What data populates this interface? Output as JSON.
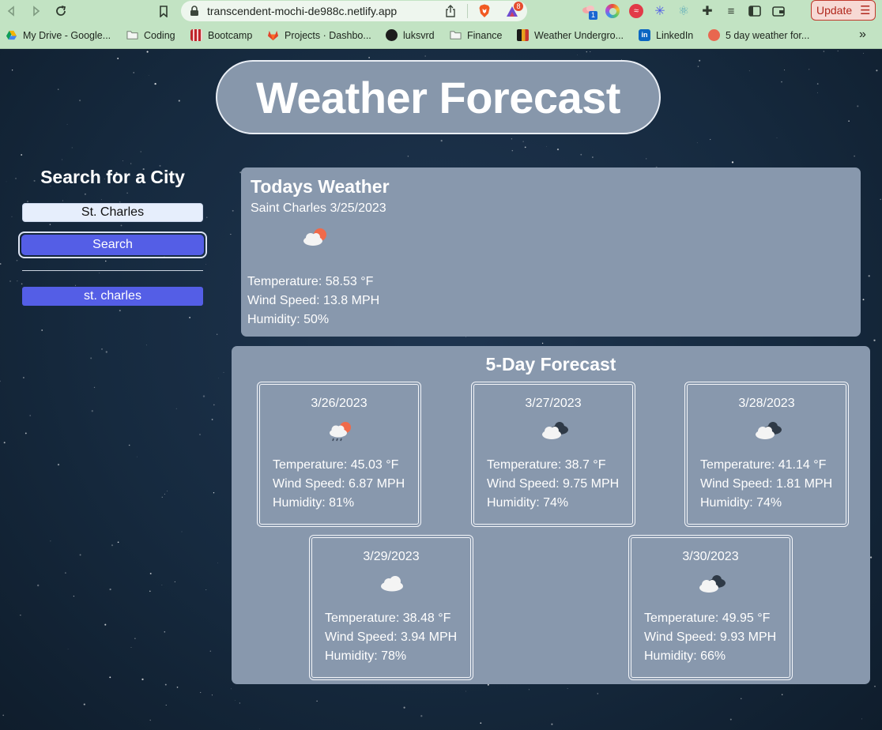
{
  "browser": {
    "url": "transcendent-mochi-de988c.netlify.app",
    "update_label": "Update",
    "extension_badge_count": "1",
    "brave_badge_count": "8",
    "bookmarks": [
      {
        "label": "My Drive - Google..."
      },
      {
        "label": "Coding"
      },
      {
        "label": "Bootcamp"
      },
      {
        "label": "Projects · Dashbo..."
      },
      {
        "label": "luksvrd"
      },
      {
        "label": "Finance"
      },
      {
        "label": "Weather Undergro..."
      },
      {
        "label": "LinkedIn"
      },
      {
        "label": "5 day weather for..."
      }
    ],
    "overflow_label": "»"
  },
  "page": {
    "title": "Weather Forecast",
    "search": {
      "heading": "Search for a City",
      "input_value": "St. Charles",
      "button_label": "Search",
      "history": [
        "st. charles"
      ]
    },
    "today": {
      "heading": "Todays Weather",
      "location_date": "Saint Charles 3/25/2023",
      "icon": "partly-cloudy-sun-icon",
      "temperature": "Temperature: 58.53 °F",
      "wind": "Wind Speed: 13.8 MPH",
      "humidity": "Humidity: 50%"
    },
    "forecast": {
      "heading": "5-Day Forecast",
      "days": [
        {
          "date": "3/26/2023",
          "icon": "rain-sun-icon",
          "temperature": "Temperature: 45.03 °F",
          "wind": "Wind Speed: 6.87 MPH",
          "humidity": "Humidity: 81%"
        },
        {
          "date": "3/27/2023",
          "icon": "overcast-clouds-icon",
          "temperature": "Temperature: 38.7 °F",
          "wind": "Wind Speed: 9.75 MPH",
          "humidity": "Humidity: 74%"
        },
        {
          "date": "3/28/2023",
          "icon": "overcast-clouds-icon",
          "temperature": "Temperature: 41.14 °F",
          "wind": "Wind Speed: 1.81 MPH",
          "humidity": "Humidity: 74%"
        },
        {
          "date": "3/29/2023",
          "icon": "cloud-icon",
          "temperature": "Temperature: 38.48 °F",
          "wind": "Wind Speed: 3.94 MPH",
          "humidity": "Humidity: 78%"
        },
        {
          "date": "3/30/2023",
          "icon": "overcast-clouds-icon",
          "temperature": "Temperature: 49.95 °F",
          "wind": "Wind Speed: 9.93 MPH",
          "humidity": "Humidity: 66%"
        }
      ]
    }
  },
  "colors": {
    "accent": "#545ee6",
    "card": "#8898ad",
    "chrome": "#c2e3c3"
  }
}
